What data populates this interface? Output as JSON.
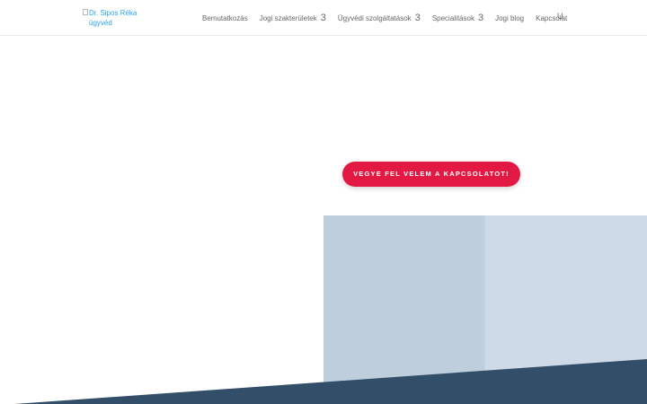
{
  "header": {
    "logo_alt": "Dr. Sipos Réka ügyvéd",
    "nav": [
      {
        "label": "Bemutatkozás",
        "caret": ""
      },
      {
        "label": "Jogi szakterületek",
        "caret": "3"
      },
      {
        "label": "Ügyvédi szolgáltatások",
        "caret": "3"
      },
      {
        "label": "Specialitások",
        "caret": "3"
      },
      {
        "label": "Jogi blog",
        "caret": ""
      },
      {
        "label": "Kapcsolat",
        "caret": ""
      }
    ],
    "search_glyph": "U"
  },
  "hero": {
    "cta_label": "VEGYE FEL VELEM A KAPCSOLATOT!"
  },
  "colors": {
    "accent": "#e21a43",
    "wedge": "#334e68",
    "link": "#2ea3f2",
    "hero_left": "#bfcedc",
    "hero_right": "#cedae7"
  },
  "icons": {
    "logo": "broken-image-icon",
    "caret": "chevron-down-icon",
    "search": "search-icon"
  }
}
